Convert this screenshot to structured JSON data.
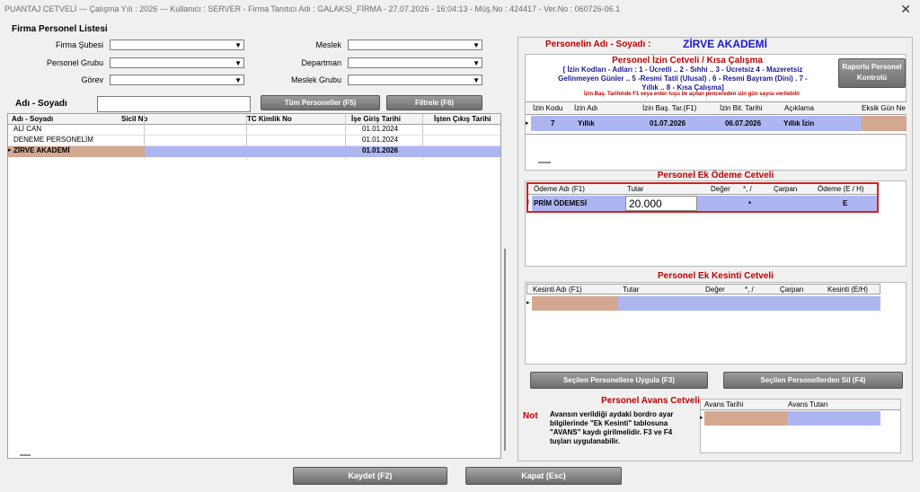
{
  "titlebar": {
    "title": "PUANTAJ CETVELİ  ---  Çalışma Yılı : 2026  ---  Kullanıcı : SERVER - Firma Tanıtıcı Adı : GALAKSİ_FİRMA - 27.07.2026 - 16:04:13 - Müş.No : 424417 - Ver.No : 060726-06.1",
    "close": "✕"
  },
  "left": {
    "section_title": "Firma Personel Listesi",
    "filters": {
      "firma_subesi": "Firma Şubesi",
      "personel_grubu": "Personel Grubu",
      "gorev": "Görev",
      "meslek": "Meslek",
      "departman": "Departman",
      "meslek_grubu": "Meslek Grubu"
    },
    "name_label": "Adı - Soyadı",
    "btn_all": "Tüm Personeller (F5)",
    "btn_filter": "Filtrele (F6)",
    "table": {
      "columns": [
        "Adı - Soyadı",
        "Sicil No",
        "TC Kimlik No",
        "İşe Giriş Tarihi",
        "İşten Çıkış Tarihi"
      ],
      "rows": [
        {
          "name": "ALİ CAN",
          "sicil": "",
          "tc": "",
          "giris": "01.01.2024",
          "cikis": ""
        },
        {
          "name": "DENEME PERSONELİM",
          "sicil": "",
          "tc": "",
          "giris": "01.01.2024",
          "cikis": ""
        },
        {
          "name": "ZİRVE  AKADEMİ",
          "sicil": "",
          "tc": "",
          "giris": "01.01.2026",
          "cikis": ""
        }
      ]
    }
  },
  "right": {
    "person_label": "Personelin Adı - Soyadı :",
    "person_name": "ZİRVE  AKADEMİ",
    "izin": {
      "title": "Personel İzin Cetveli / Kısa Çalışma",
      "codes_line1": "[ İzin Kodları - Adları : 1 - Ücretli .. 2 - Sıhhi  .. 3 - Ücretsiz   4 - Mazeretsiz",
      "codes_line2": "Gelinmeyen Günler .. 5 -Resmi Tatil  (Ulusal) . 6 - Resmi Bayram (Dini) . 7 -",
      "codes_line3": "Yıllık .. 8 - Kısa Çalışma]",
      "hint": "İzin Baş. Tarihinde F1 veya enter tuşu ile açılan pencereden izin gün sayısı verilebilir",
      "btn_report": "Raporlu Personel Kontrolü",
      "columns": [
        "İzin Kodu",
        "İzin Adı",
        "İzin Baş. Tar.(F1)",
        "İzin Bit. Tarihi",
        "Açıklama",
        "Eksik Gün Ne"
      ],
      "row": {
        "kod": "7",
        "ad": "Yıllık",
        "bas": "01.07.2026",
        "bit": "06.07.2026",
        "aciklama": "Yıllık İzin",
        "eksik": ""
      }
    },
    "ek_odeme": {
      "title": "Personel Ek Ödeme Cetveli",
      "columns": [
        "Ödeme Adı (F1)",
        "Tutar",
        "Değer",
        "*, /",
        "Çarpan",
        "Ödeme (E / H)"
      ],
      "row": {
        "ad": "PRİM ÖDEMESİ",
        "tutar": "20.000",
        "deger": "",
        "op": "*",
        "carpan": "",
        "eh": "E"
      }
    },
    "ek_kesinti": {
      "title": "Personel Ek Kesinti Cetveli",
      "columns": [
        "Kesinti Adı (F1)",
        "Tutar",
        "Değer",
        "*, /",
        "Çarpan",
        "Kesinti (E/H)"
      ]
    },
    "btn_apply": "Seçilen Personellere Uygula (F3)",
    "btn_delete": "Seçilen Personellerden Sil (F4)",
    "avans": {
      "title": "Personel Avans Cetveli",
      "not_label": "Not",
      "note": "Avansın verildiği aydaki bordro ayar bilgilerinde \"Ek Kesinti\" tablosuna \"AVANS\" kaydı girilmelidir. F3 ve F4 tuşları uygulanabilir.",
      "columns": [
        "Avans Tarihi",
        "Avans Tutarı"
      ]
    }
  },
  "footer": {
    "save": "Kaydet (F2)",
    "close": "Kapat (Esc)"
  }
}
